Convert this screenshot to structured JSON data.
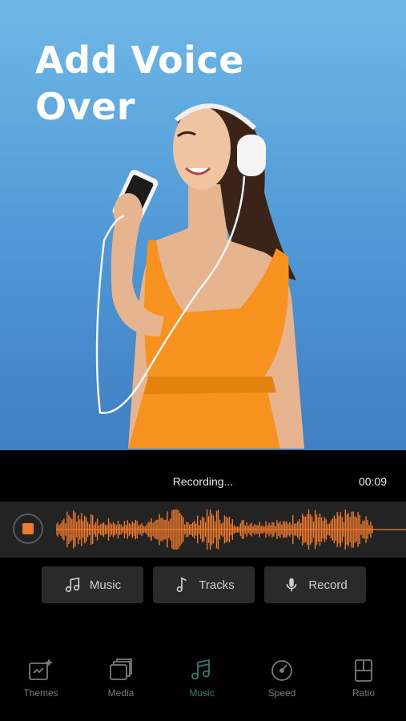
{
  "hero": {
    "title": "Add Voice Over"
  },
  "recording": {
    "status": "Recording...",
    "time": "00:09"
  },
  "buttons": {
    "music": "Music",
    "tracks": "Tracks",
    "record": "Record"
  },
  "tabs": [
    {
      "label": "Themes",
      "icon": "themes-icon"
    },
    {
      "label": "Media",
      "icon": "media-icon"
    },
    {
      "label": "Music",
      "icon": "music-note-icon"
    },
    {
      "label": "Speed",
      "icon": "speed-icon"
    },
    {
      "label": "Ratio",
      "icon": "ratio-icon"
    }
  ],
  "colors": {
    "accent": "#f07a2e",
    "active_tab": "#2e7d6f",
    "hero_top": "#6fb8e6",
    "hero_bottom": "#3f7fc2"
  }
}
